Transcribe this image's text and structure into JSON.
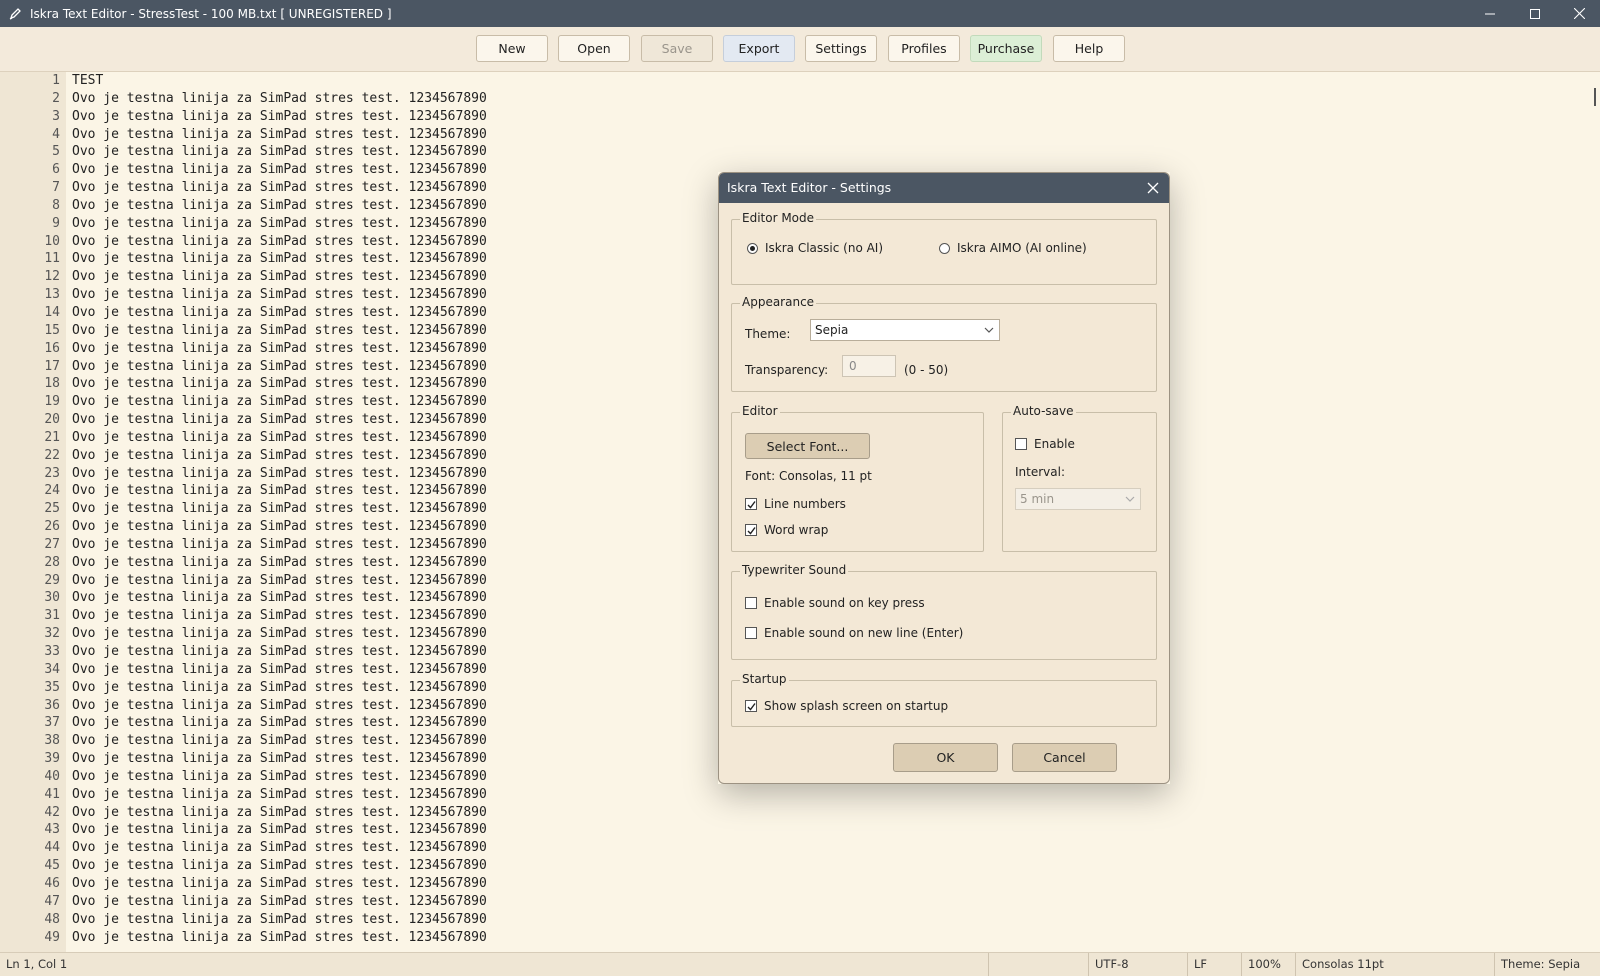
{
  "window": {
    "title": "Iskra Text Editor - StressTest - 100 MB.txt  [ UNREGISTERED ]"
  },
  "toolbar": {
    "new": "New",
    "open": "Open",
    "save": "Save",
    "export": "Export",
    "settings": "Settings",
    "profiles": "Profiles",
    "purchase": "Purchase",
    "help": "Help"
  },
  "editor": {
    "first_line": "TEST",
    "repeat_line": "Ovo je testna linija za SimPad stres test. 1234567890",
    "visible_line_count": 49
  },
  "status": {
    "position": "Ln 1, Col 1",
    "encoding": "UTF-8",
    "eol": "LF",
    "zoom": "100%",
    "font": "Consolas 11pt",
    "theme": "Theme: Sepia"
  },
  "dialog": {
    "title": "Iskra Text Editor - Settings",
    "editor_mode": {
      "label": "Editor Mode",
      "classic": "Iskra Classic (no AI)",
      "aimo": "Iskra AIMO (AI online)",
      "selected": "classic"
    },
    "appearance": {
      "label": "Appearance",
      "theme_label": "Theme:",
      "theme_value": "Sepia",
      "transparency_label": "Transparency:",
      "transparency_value": "0",
      "transparency_range": "(0 - 50)"
    },
    "editor": {
      "label": "Editor",
      "select_font": "Select Font...",
      "font_info": "Font: Consolas, 11 pt",
      "line_numbers": "Line numbers",
      "line_numbers_checked": true,
      "word_wrap": "Word wrap",
      "word_wrap_checked": true
    },
    "autosave": {
      "label": "Auto-save",
      "enable": "Enable",
      "enable_checked": false,
      "interval_label": "Interval:",
      "interval_value": "5 min"
    },
    "typewriter": {
      "label": "Typewriter Sound",
      "keypress": "Enable sound on key press",
      "newline": "Enable sound on new line (Enter)"
    },
    "startup": {
      "label": "Startup",
      "splash": "Show splash screen on startup",
      "splash_checked": true
    },
    "ok": "OK",
    "cancel": "Cancel"
  }
}
